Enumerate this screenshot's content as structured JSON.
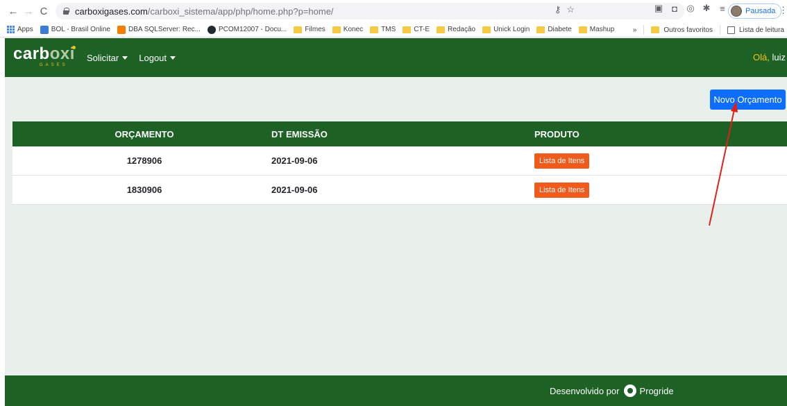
{
  "browser": {
    "url_domain": "carboxigases.com",
    "url_path": "/carboxi_sistema/app/php/home.php?p=home/",
    "profile_label": "Pausada",
    "bookmarks": [
      {
        "label": "Apps",
        "icon": "apps-grid-icon"
      },
      {
        "label": "BOL - Brasil Online",
        "icon": "bol-icon"
      },
      {
        "label": "DBA SQLServer: Rec...",
        "icon": "blogger-icon"
      },
      {
        "label": "PCOM12007 - Docu...",
        "icon": "github-icon"
      },
      {
        "label": "Filmes",
        "icon": "folder-icon"
      },
      {
        "label": "Konec",
        "icon": "folder-icon"
      },
      {
        "label": "TMS",
        "icon": "folder-icon"
      },
      {
        "label": "CT-E",
        "icon": "folder-icon"
      },
      {
        "label": "Redação",
        "icon": "folder-icon"
      },
      {
        "label": "Unick Login",
        "icon": "folder-icon"
      },
      {
        "label": "Diabete",
        "icon": "folder-icon"
      },
      {
        "label": "Mashup",
        "icon": "folder-icon"
      }
    ],
    "overflow_label": "»",
    "other_favorites": "Outros favoritos",
    "reading_list": "Lista de leitura"
  },
  "site": {
    "logo_main": "carb",
    "logo_accent": "oxi",
    "logo_sub": "GASES",
    "menu": [
      {
        "label": "Solicitar"
      },
      {
        "label": "Logout"
      }
    ],
    "greeting_hello": "Olá,",
    "greeting_user": "luiz",
    "new_button": "Novo Orçamento",
    "table": {
      "headers": [
        "ORÇAMENTO",
        "DT EMISSÃO",
        "PRODUTO"
      ],
      "rows": [
        {
          "orcamento": "1278906",
          "dt_emissao": "2021-09-06",
          "produto_button": "Lista de Itens"
        },
        {
          "orcamento": "1830906",
          "dt_emissao": "2021-09-06",
          "produto_button": "Lista de Itens"
        }
      ]
    },
    "footer_text": "Desenvolvido por",
    "footer_brand": "Progride"
  },
  "colors": {
    "primary_green": "#1d6124",
    "content_bg": "#e9efea",
    "blue_button": "#0d6efd",
    "orange_button": "#f05a1a",
    "accent_yellow": "#f2c21a",
    "annotation_red": "#e0201a"
  }
}
